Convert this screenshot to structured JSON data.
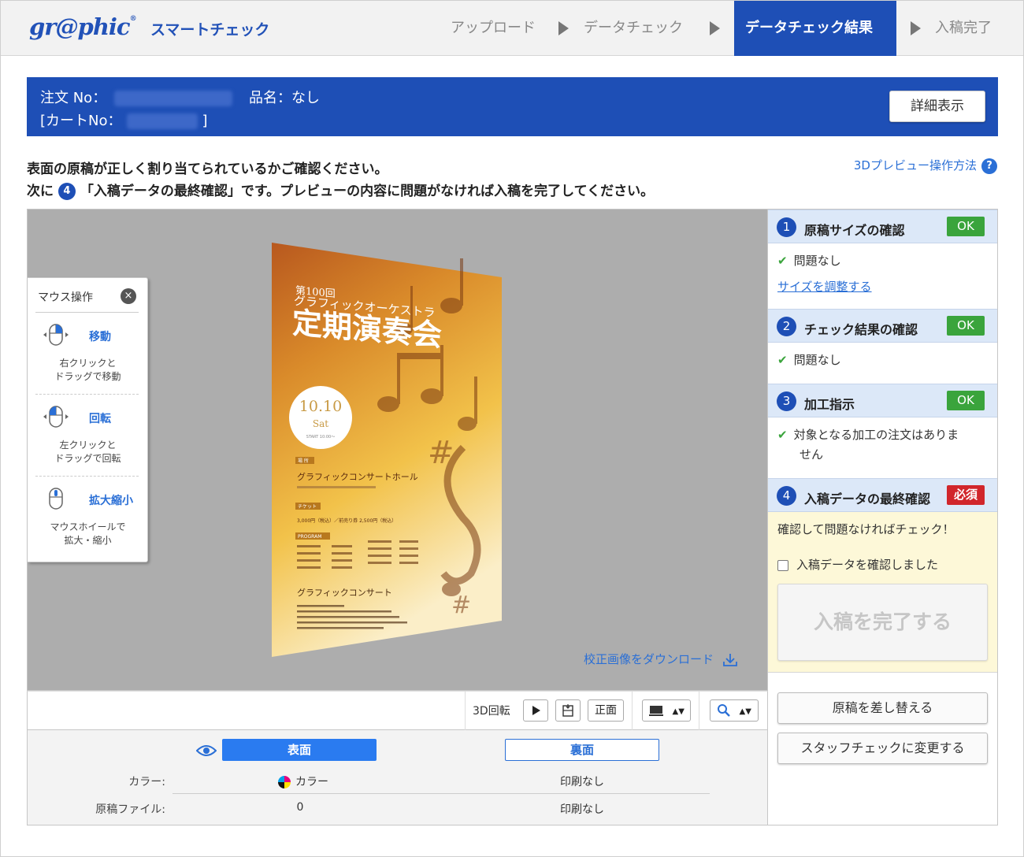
{
  "header": {
    "logo": "gr@phic",
    "logo_mark": "®",
    "app_title": "スマートチェック",
    "steps": [
      "アップロード",
      "データチェック",
      "データチェック結果",
      "入稿完了"
    ],
    "active_step": 2
  },
  "order": {
    "order_no_label": "注文 No：",
    "product_label": "品名：なし",
    "cart_no_open": "[カートNo：",
    "cart_no_close": "]",
    "detail_button": "詳細表示"
  },
  "instructions": {
    "line1": "表面の原稿が正しく割り当てられているかご確認ください。",
    "line2_prefix": "次に",
    "line2_num": "4",
    "line2_rest": "「入稿データの最終確認」です。プレビューの内容に問題がなければ入稿を完了してください。",
    "howto_link": "3Dプレビュー操作方法",
    "howto_icon": "?"
  },
  "mouse_panel": {
    "title": "マウス操作",
    "close_icon": "×",
    "items": [
      {
        "label": "移動",
        "desc1": "右クリックと",
        "desc2": "ドラッグで移動"
      },
      {
        "label": "回転",
        "desc1": "左クリックと",
        "desc2": "ドラッグで回転"
      },
      {
        "label": "拡大縮小",
        "desc1": "マウスホイールで",
        "desc2": "拡大・縮小"
      }
    ]
  },
  "poster": {
    "edition": "第100回",
    "orchestra": "グラフィックオーケストラ",
    "title": "定期演奏会",
    "date": "10.10",
    "day": "Sat",
    "start": "START 10:00〜",
    "venue_label": "場 所",
    "venue": "グラフィックコンサートホール",
    "ticket_label": "チケット",
    "ticket": "3,000円（税込）／前売り券 2,500円（税込）",
    "program_label": "PROGRAM",
    "organizer": "グラフィックコンサート"
  },
  "download_link": "校正画像をダウンロード",
  "toolbar": {
    "rotate_label": "3D回転",
    "front_button": "正面"
  },
  "faces": {
    "front_label": "表面",
    "back_label": "裏面",
    "color_label": "カラー:",
    "file_label": "原稿ファイル:",
    "front_color": "カラー",
    "back_color": "印刷なし",
    "front_file": "0",
    "back_file": "印刷なし"
  },
  "checks": [
    {
      "num": "1",
      "title": "原稿サイズの確認",
      "status": "OK",
      "result": "問題なし",
      "link": "サイズを調整する"
    },
    {
      "num": "2",
      "title": "チェック結果の確認",
      "status": "OK",
      "result": "問題なし"
    },
    {
      "num": "3",
      "title": "加工指示",
      "status": "OK",
      "result1": "対象となる加工の注文はありま",
      "result2": "せん"
    },
    {
      "num": "4",
      "title": "入稿データの最終確認",
      "status": "必須",
      "prompt": "確認して問題なければチェック！",
      "checkbox_label": "入稿データを確認しました",
      "complete_button": "入稿を完了する"
    }
  ],
  "actions": {
    "replace_button": "原稿を差し替える",
    "staff_button": "スタッフチェックに変更する"
  },
  "colors": {
    "brand": "#1e4fb6",
    "ok": "#3aa43c",
    "required": "#d1262b",
    "link": "#2a6fd6"
  }
}
